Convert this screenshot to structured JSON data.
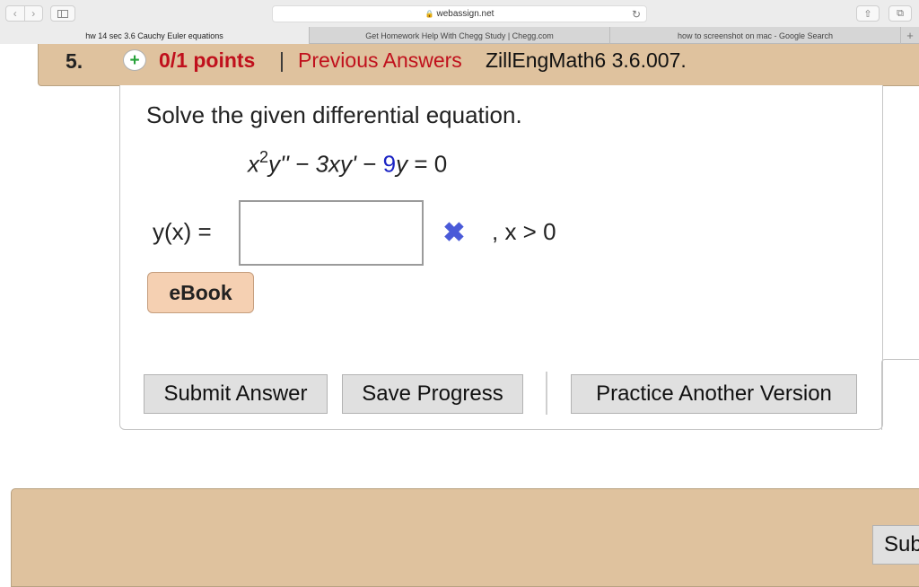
{
  "browser": {
    "url": "webassign.net",
    "tabs": [
      {
        "label": "hw 14 sec 3.6 Cauchy Euler equations"
      },
      {
        "label": "Get Homework Help With Chegg Study | Chegg.com"
      },
      {
        "label": "how to screenshot on mac - Google Search"
      }
    ],
    "icons": {
      "back": "chevron-left-icon",
      "forward": "chevron-right-icon",
      "sidebar": "sidebar-icon",
      "lock": "lock-icon",
      "reload": "reload-icon",
      "share": "share-icon",
      "tabs": "tabs-icon",
      "new_tab": "plus-icon"
    }
  },
  "question": {
    "number": "5.",
    "points": "0/1 points",
    "separator": "|",
    "previous_answers": "Previous Answers",
    "problem_id": "ZillEngMath6 3.6.007.",
    "prompt": "Solve the given differential equation.",
    "equation": {
      "base": "x",
      "exponent": "2",
      "term1": "y'' − 3",
      "term2": "xy'",
      "minus": " − ",
      "coefficient": "9",
      "term3": "y",
      "rhs": " = 0"
    },
    "answer_label": "y(x) =",
    "answer_value": "",
    "answer_status": "incorrect",
    "domain": ", x > 0"
  },
  "buttons": {
    "ebook": "eBook",
    "submit": "Submit Answer",
    "save": "Save Progress",
    "practice": "Practice Another Version",
    "next_submit": "Sub"
  },
  "colors": {
    "header_bg": "#dfc29e",
    "points_red": "#c0101c",
    "incorrect_x": "#4a5ad8",
    "coefficient_blue": "#1b24c4",
    "ebook_bg": "#f5d0b2"
  }
}
